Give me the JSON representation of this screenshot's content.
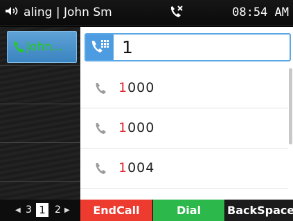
{
  "status_bar": {
    "call_status": "aling | John Sm",
    "time": "08:54 AM",
    "icons": [
      "speaker-icon",
      "missed-call-icon"
    ]
  },
  "line_keys": [
    {
      "label": "John..."
    }
  ],
  "dial": {
    "input_value": "1"
  },
  "results": [
    {
      "match": "1",
      "rest": "000"
    },
    {
      "match": "1",
      "rest": "000"
    },
    {
      "match": "1",
      "rest": "004"
    }
  ],
  "pager": {
    "prev": "3",
    "current": "1",
    "next": "2"
  },
  "softkeys": {
    "end_call": "EndCall",
    "dial": "Dial",
    "backspace": "BackSpace"
  },
  "colors": {
    "accent_blue": "#4d9be0",
    "highlight_red": "#e0262a",
    "end_call_red": "#ee3b30",
    "dial_green": "#2cb84a",
    "line_label_green": "#22cc22"
  }
}
